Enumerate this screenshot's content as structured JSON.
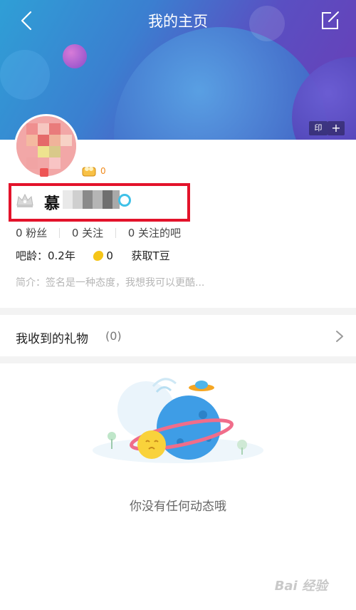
{
  "header": {
    "title": "我的主页",
    "stamp_label": "印",
    "plus_label": "+",
    "back_icon": "chevron-left-icon",
    "edit_icon": "edit-icon"
  },
  "profile": {
    "coin_count": "0",
    "username": "慕",
    "stats": {
      "fans": "0 粉丝",
      "following": "0 关注",
      "bars": "0 关注的吧"
    },
    "bar_age": "吧龄：0.2年",
    "tdou_count": "0",
    "get_tdou": "获取T豆",
    "intro": "简介：签名是一种态度，我想我可以更酷..."
  },
  "gifts": {
    "label": "我收到的礼物",
    "count": "(0)"
  },
  "feed": {
    "empty_text": "你没有任何动态哦"
  },
  "watermark": "Bai 经验",
  "colors": {
    "highlight": "#e3132b",
    "banner_start": "#2f9fd6",
    "banner_end": "#6a3db6",
    "coin": "#f08a1c"
  }
}
